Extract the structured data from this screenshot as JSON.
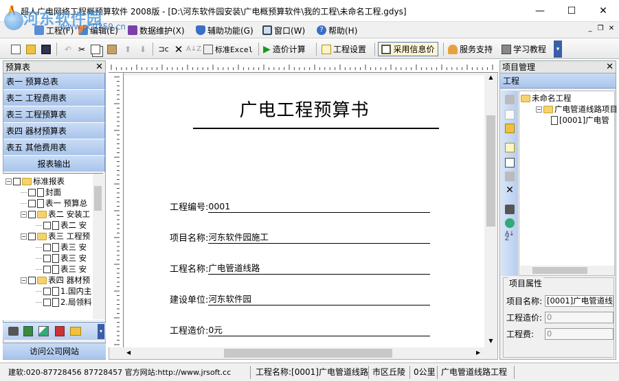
{
  "window": {
    "title": "超人广电网络工程概预算软件 2008版 - [D:\\河东软件园安装\\广电概预算软件\\我的工程\\未命名工程.gdys]",
    "watermark_title": "河东软件园",
    "watermark_url": "www.pc0359.cn",
    "controls": {
      "minimize": "—",
      "maximize": "☐",
      "close": "✕"
    },
    "mdi_controls": {
      "minimize": "_",
      "restore": "❐",
      "close": "✕"
    }
  },
  "menu": [
    {
      "label": "工程(F)",
      "icon": "project-icon"
    },
    {
      "label": "编辑(E)",
      "icon": "edit-icon"
    },
    {
      "label": "数据维护(X)",
      "icon": "data-maintain-icon"
    },
    {
      "label": "辅助功能(G)",
      "icon": "aux-icon"
    },
    {
      "label": "窗口(W)",
      "icon": "window-icon"
    },
    {
      "label": "帮助(H)",
      "icon": "help-icon"
    }
  ],
  "toolbar": {
    "standard_excel": "标准Excel",
    "cost_calc": "造价计算",
    "project_settings": "工程设置",
    "use_info_price": "采用信息价",
    "service_support": "服务支持",
    "learn_tutorial": "学习教程"
  },
  "left_panel": {
    "header": "预算表",
    "close": "✕",
    "nav": [
      "表一  预算总表",
      "表二  工程费用表",
      "表三  工程预算表",
      "表四  器材预算表",
      "表五  其他费用表"
    ],
    "report_output": "报表输出",
    "tree": [
      {
        "label": "标准报表",
        "level": 0,
        "type": "folder",
        "expand": "-"
      },
      {
        "label": "封面",
        "level": 1,
        "type": "doc"
      },
      {
        "label": "表一  预算总",
        "level": 1,
        "type": "doc"
      },
      {
        "label": "表二  安装工",
        "level": 1,
        "type": "folder",
        "expand": "-"
      },
      {
        "label": "表二  安",
        "level": 2,
        "type": "doc"
      },
      {
        "label": "表三  工程预",
        "level": 1,
        "type": "folder",
        "expand": "-"
      },
      {
        "label": "表三  安",
        "level": 2,
        "type": "doc"
      },
      {
        "label": "表三  安",
        "level": 2,
        "type": "doc"
      },
      {
        "label": "表三  安",
        "level": 2,
        "type": "doc"
      },
      {
        "label": "表四  器材预",
        "level": 1,
        "type": "folder",
        "expand": "-"
      },
      {
        "label": "1.国内主",
        "level": 2,
        "type": "doc"
      },
      {
        "label": "2.局领料",
        "level": 2,
        "type": "doc"
      }
    ],
    "visit_site": "访问公司网站"
  },
  "document": {
    "title": "广电工程预算书",
    "fields": [
      {
        "label": "工程编号:",
        "value": "0001"
      },
      {
        "label": "项目名称:",
        "value": "河东软件园施工"
      },
      {
        "label": "工程名称:",
        "value": "广电管道线路"
      },
      {
        "label": "建设单位:",
        "value": "河东软件园"
      },
      {
        "label": "工程造价:",
        "value": "0元"
      }
    ]
  },
  "right_panel": {
    "header": "项目管理",
    "close": "✕",
    "tab": "工程",
    "tree": [
      {
        "label": "未命名工程",
        "level": 0
      },
      {
        "label": "广电管道线路项目",
        "level": 1
      },
      {
        "label": "[0001]广电管",
        "level": 2
      }
    ],
    "props_title": "项目属性",
    "props": [
      {
        "label": "项目名称:",
        "value": "[0001]广电管道线"
      },
      {
        "label": "工程造价:",
        "value": "0"
      },
      {
        "label": "工程费:",
        "value": "0"
      }
    ]
  },
  "status": {
    "contact": "建软:020-87728456 87728457 官方网站:http://www.jrsoft.cc",
    "project_name": "工程名称:[0001]广电管道线路",
    "region": "市区丘陵",
    "distance": "0公里",
    "type": "广电管道线路工程"
  }
}
